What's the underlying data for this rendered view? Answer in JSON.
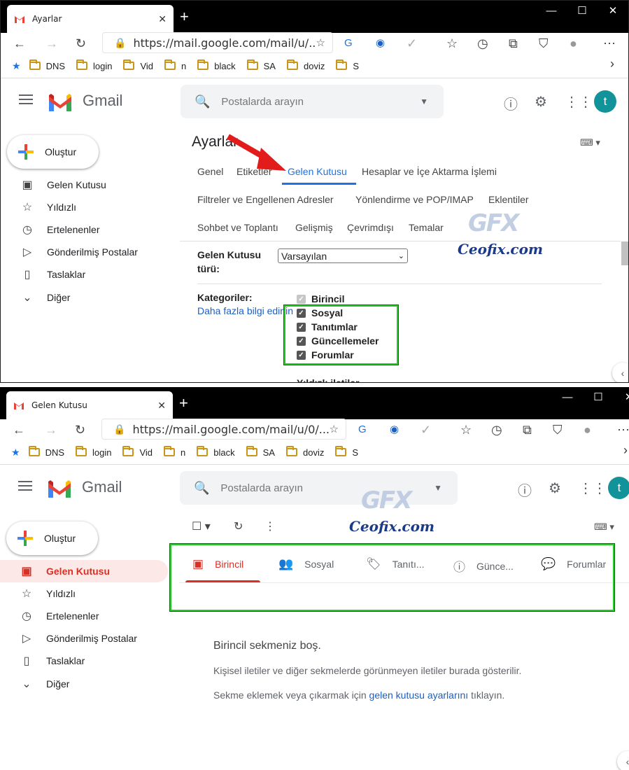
{
  "window1": {
    "tab_title": "Ayarlar",
    "url": "https://mail.google.com/mail/u/...",
    "bookmarks": [
      "DNS",
      "login",
      "Vid",
      "n",
      "black",
      "SA",
      "doviz",
      "S"
    ],
    "gmail_word": "Gmail",
    "search_placeholder": "Postalarda arayın",
    "avatar_letter": "t",
    "compose_label": "Oluştur",
    "nav": [
      "Gelen Kutusu",
      "Yıldızlı",
      "Ertelenenler",
      "Gönderilmiş Postalar",
      "Taslaklar",
      "Diğer"
    ],
    "settings_title": "Ayarlar",
    "settings_tabs_row1": [
      "Genel",
      "Etiketler",
      "Gelen Kutusu",
      "Hesaplar ve İçe Aktarma İşlemi"
    ],
    "settings_tabs_row2": [
      "Filtreler ve Engellenen Adresler",
      "Yönlendirme ve POP/IMAP",
      "Eklentiler"
    ],
    "settings_tabs_row3": [
      "Sohbet ve Toplantı",
      "Gelişmiş",
      "Çevrimdışı",
      "Temalar"
    ],
    "inbox_type_label_1": "Gelen Kutusu",
    "inbox_type_label_2": "türü:",
    "inbox_type_value": "Varsayılan",
    "categories_label": "Kategoriler:",
    "learn_more": "Daha fazla bilgi edinin",
    "categories": [
      "Birincil",
      "Sosyal",
      "Tanıtımlar",
      "Güncellemeler",
      "Forumlar"
    ],
    "starred_partial": "Yıldızlı iletiler"
  },
  "window2": {
    "tab_title": "Gelen Kutusu",
    "url": "https://mail.google.com/mail/u/0/...",
    "bookmarks": [
      "DNS",
      "login",
      "Vid",
      "n",
      "black",
      "SA",
      "doviz",
      "S"
    ],
    "gmail_word": "Gmail",
    "search_placeholder": "Postalarda arayın",
    "avatar_letter": "t",
    "compose_label": "Oluştur",
    "nav": [
      "Gelen Kutusu",
      "Yıldızlı",
      "Ertelenenler",
      "Gönderilmiş Postalar",
      "Taslaklar",
      "Diğer"
    ],
    "inbox_tabs": [
      "Birincil",
      "Sosyal",
      "Tanıtı...",
      "Günce...",
      "Forumlar"
    ],
    "empty_title": "Birincil sekmeniz boş.",
    "empty_desc": "Kişisel iletiler ve diğer sekmelerde görünmeyen iletiler burada gösterilir.",
    "empty_hint_before": "Sekme eklemek veya çıkarmak için",
    "empty_hint_link": "gelen kutusu ayarlarını",
    "empty_hint_after": "tıklayın."
  },
  "watermark": {
    "logo": "GFX",
    "text": "Ceofix.com"
  },
  "colors": {
    "accent": "#1a73e8",
    "active_red": "#d93025",
    "highlight_green": "#22cc22",
    "avatar": "#12939a"
  }
}
